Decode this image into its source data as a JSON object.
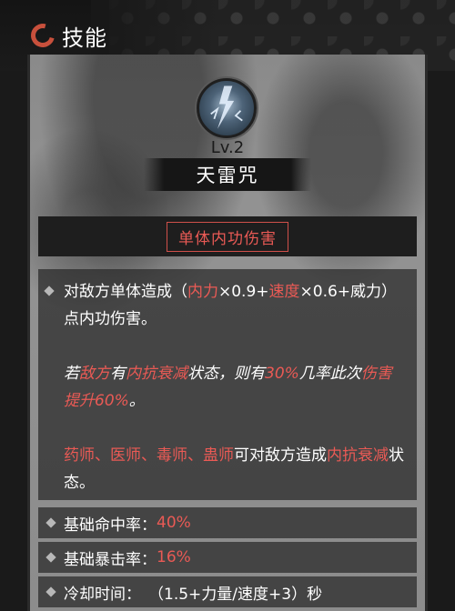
{
  "header": {
    "title": "技能"
  },
  "skill": {
    "level": "Lv.2",
    "name": "天雷咒",
    "type": "单体内功伤害"
  },
  "description": {
    "p1": {
      "a": "对敌方单体造成（",
      "b": "内力",
      "c": "×0.9+",
      "d": "速度",
      "e": "×0.6+威力）点内功伤害。"
    },
    "p2": {
      "a": "若",
      "b": "敌方",
      "c": "有",
      "d": "内抗衰减",
      "e": "状态，则有",
      "f": "30%",
      "g": "几率此次",
      "h": "伤害提升60%",
      "i": "。"
    },
    "p3": {
      "a": "药师、医师、毒师、蛊师",
      "b": "可对敌方造成",
      "c": "内抗衰减",
      "d": "状态。"
    }
  },
  "stats": {
    "hit_label": "基础命中率：",
    "hit_value": "40%",
    "crit_label": "基础暴击率：",
    "crit_value": "16%",
    "cooldown_label": "冷却时间：",
    "cooldown_value": "（1.5+力量/速度+3）秒"
  },
  "colors": {
    "highlight": "#ea5a55",
    "panel": "#8f8f8f"
  }
}
